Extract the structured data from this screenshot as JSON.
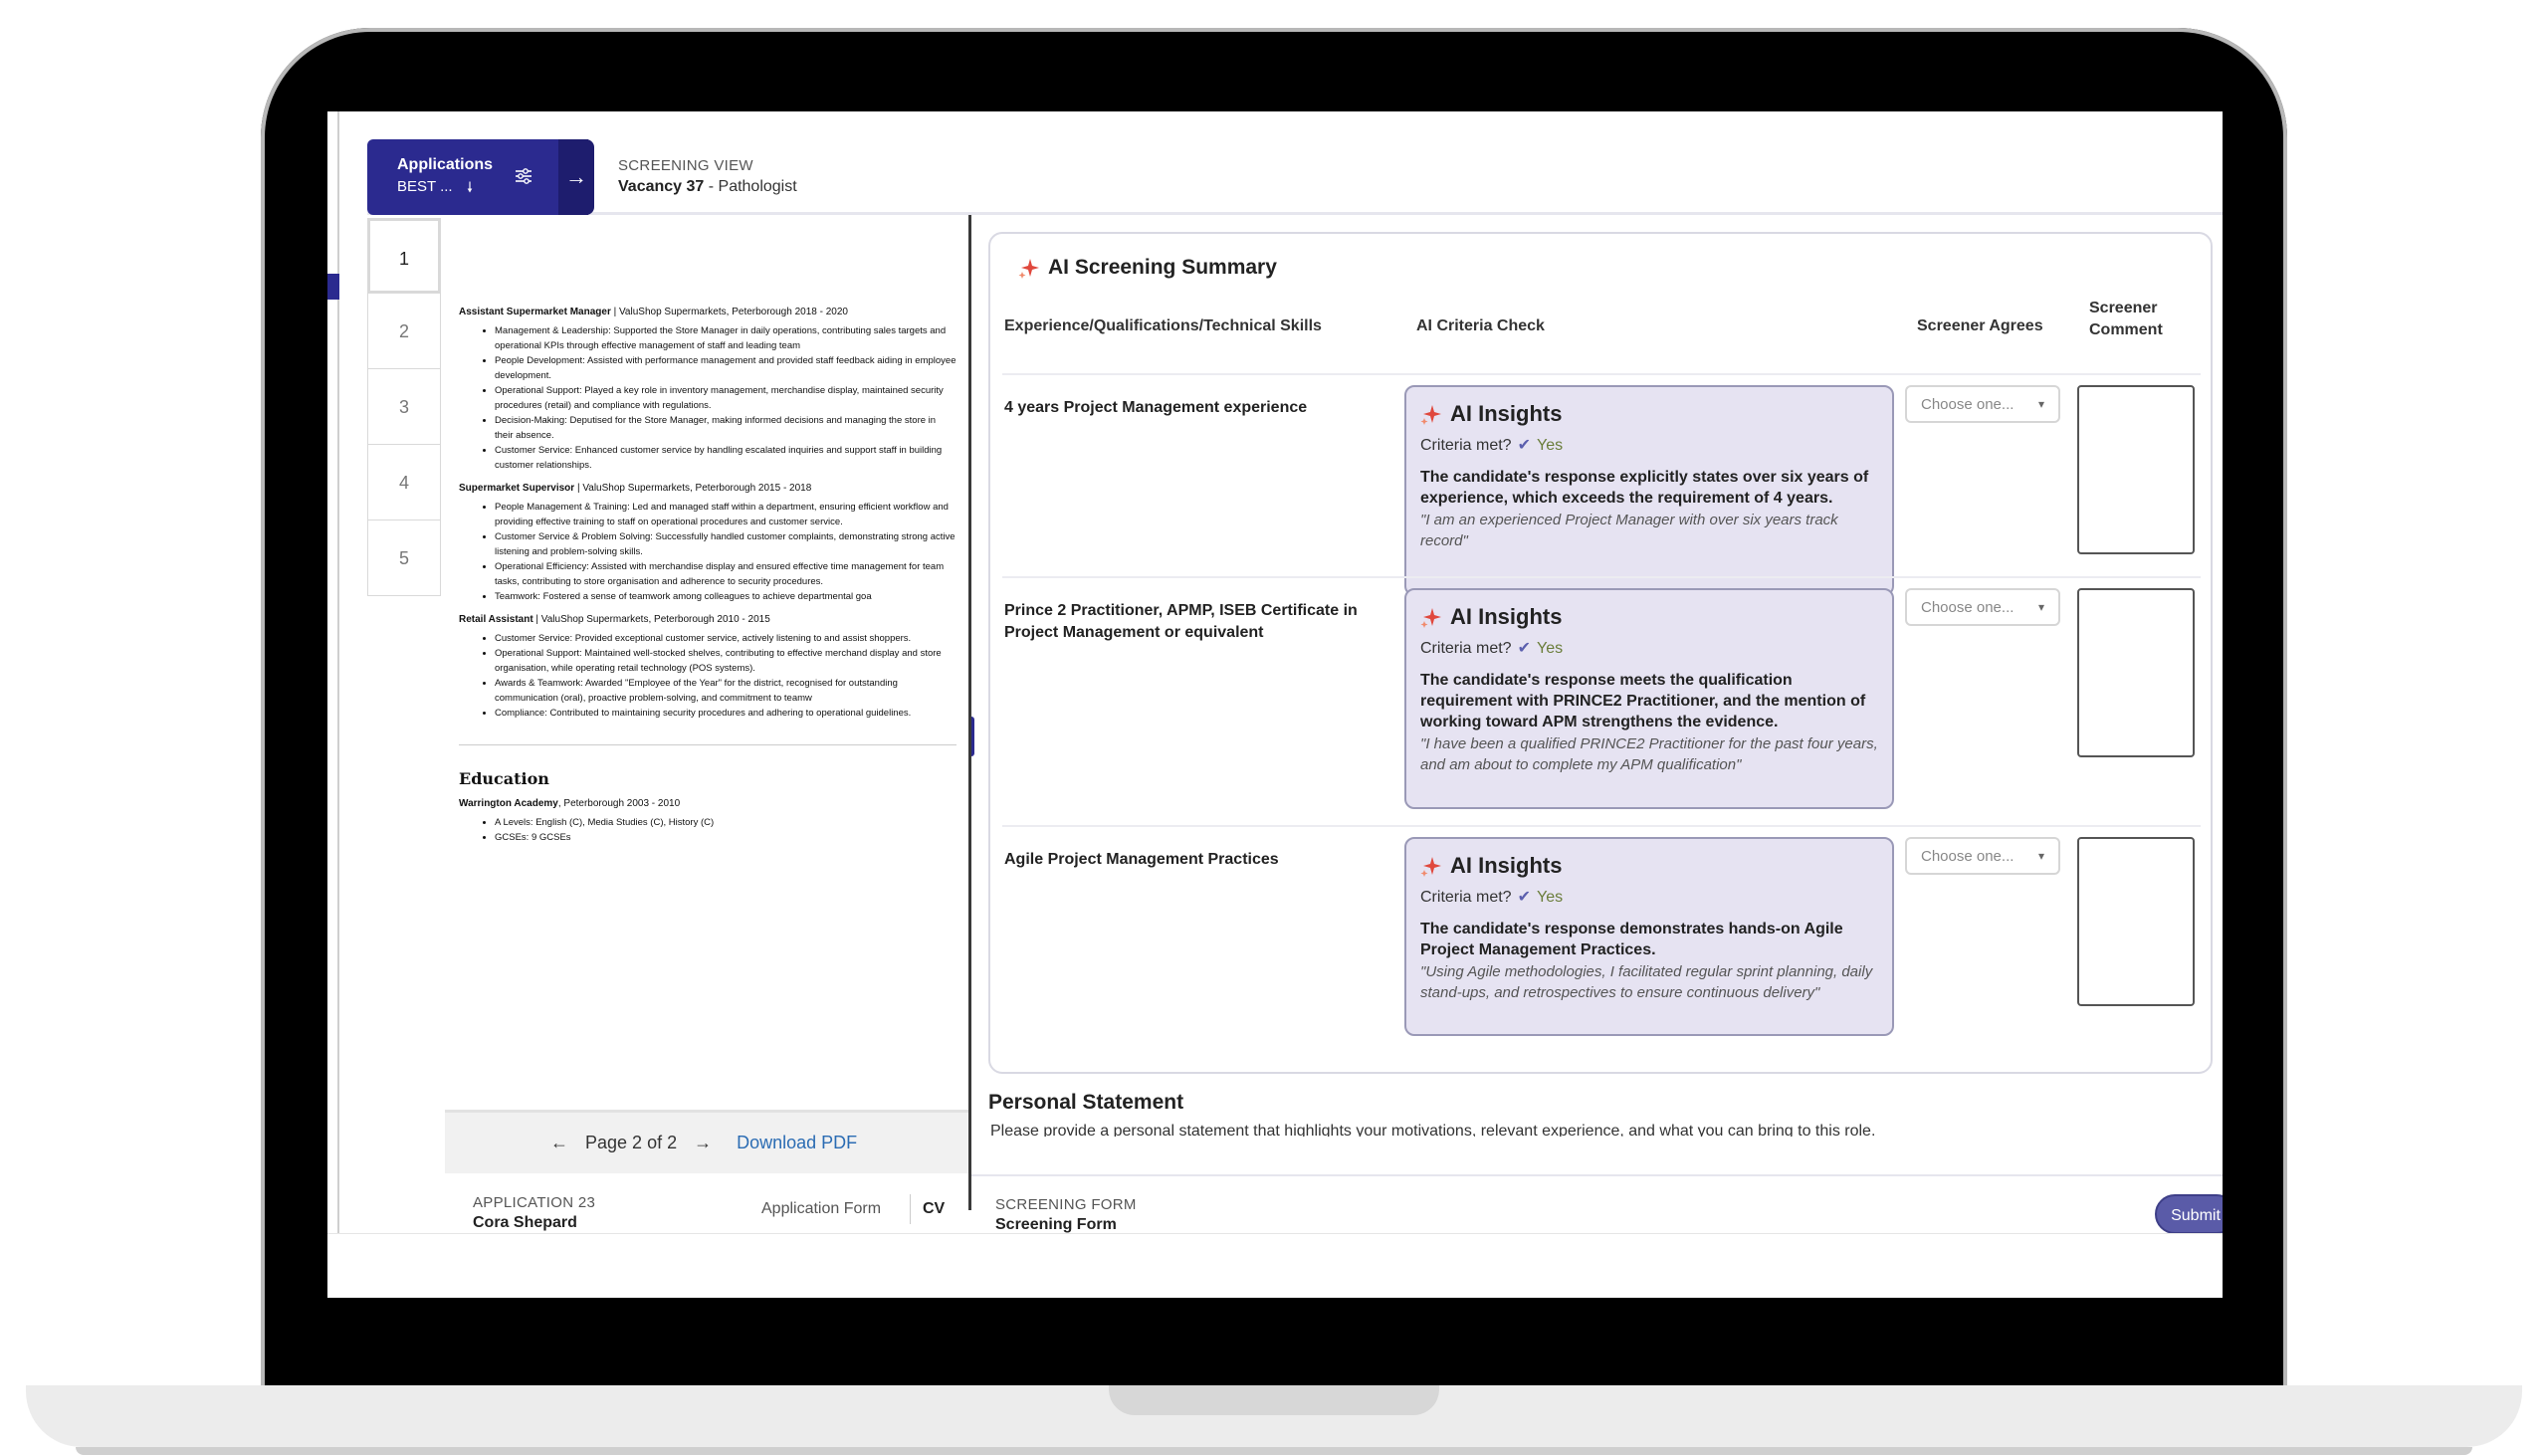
{
  "header": {
    "applications_label": "Applications",
    "sort_label": "BEST ...",
    "view_label": "SCREENING VIEW",
    "vacancy_bold": "Vacancy 37",
    "vacancy_rest": " - Pathologist"
  },
  "pages": [
    "1",
    "2",
    "3",
    "4",
    "5"
  ],
  "cv": {
    "jobs": [
      {
        "title": "Assistant Supermarket Manager",
        "meta": " | ValuShop Supermarkets, Peterborough 2018 - 2020",
        "bullets": [
          "Management & Leadership: Supported the Store Manager in daily operations, contributing sales targets and operational KPIs through effective management of staff and leading team",
          "People Development: Assisted with performance management and provided staff feedback aiding in employee development.",
          "Operational Support: Played a key role in inventory management, merchandise display, maintained security procedures (retail) and compliance with regulations.",
          "Decision-Making: Deputised for the Store Manager, making informed decisions and managing the store in their absence.",
          "Customer Service: Enhanced customer service by handling escalated inquiries and support staff in building customer relationships."
        ]
      },
      {
        "title": "Supermarket Supervisor",
        "meta": " | ValuShop Supermarkets, Peterborough 2015 - 2018",
        "bullets": [
          "People Management & Training: Led and managed staff within a department, ensuring efficient workflow and providing effective training to staff on operational procedures and customer service.",
          "Customer Service & Problem Solving: Successfully handled customer complaints, demonstrating strong active listening and problem-solving skills.",
          "Operational Efficiency: Assisted with merchandise display and ensured effective time management for team tasks, contributing to store organisation and adherence to security procedures.",
          "Teamwork: Fostered a sense of teamwork among colleagues to achieve departmental goa"
        ]
      },
      {
        "title": "Retail Assistant",
        "meta": " | ValuShop Supermarkets, Peterborough 2010 - 2015",
        "bullets": [
          "Customer Service: Provided exceptional customer service, actively listening to and assist shoppers.",
          "Operational Support: Maintained well-stocked shelves, contributing to effective merchand display and store organisation, while operating retail technology (POS systems).",
          "Awards & Teamwork: Awarded \"Employee of the Year\" for the district, recognised for outstanding communication (oral), proactive problem-solving, and commitment to teamw",
          "Compliance: Contributed to maintaining security procedures and adhering to operational guidelines."
        ]
      }
    ],
    "education_title": "Education",
    "education": {
      "title": "Warrington Academy",
      "meta": ", Peterborough 2003 - 2010",
      "bullets": [
        "A Levels: English (C), Media Studies (C), History (C)",
        "GCSEs: 9 GCSEs"
      ]
    }
  },
  "pdf_nav": {
    "page_label": "Page 2 of 2",
    "download_label": "Download PDF"
  },
  "application": {
    "label": "APPLICATION 23",
    "name": "Cora Shepard",
    "form_tab": "Application Form",
    "cv_tab": "CV"
  },
  "summary": {
    "title": "AI Screening Summary",
    "col_requirement": "Experience/Qualifications/Technical Skills",
    "col_ai": "AI Criteria Check",
    "col_agrees": "Screener Agrees",
    "col_comment_1": "Screener",
    "col_comment_2": "Comment",
    "insight_title": "AI Insights",
    "criteria_label": "Criteria met?",
    "select_placeholder": "Choose one...",
    "rows": [
      {
        "requirement": "4 years Project Management experience",
        "met": "Yes",
        "explanation": "The candidate's response explicitly states over six years of experience, which exceeds the requirement of 4 years.",
        "quote": "\"I am an experienced Project Manager with over six years track record\""
      },
      {
        "requirement": "Prince 2 Practitioner, APMP, ISEB Certificate in Project Management or equivalent",
        "met": "Yes",
        "explanation": "The candidate's response meets the qualification requirement with PRINCE2 Practitioner, and the mention of working toward APM strengthens the evidence.",
        "quote": "\"I have been a qualified PRINCE2 Practitioner for the past four years, and am about to complete my APM qualification\""
      },
      {
        "requirement": "Agile Project Management Practices",
        "met": "Yes",
        "explanation": "The candidate's response demonstrates hands-on Agile Project Management Practices.",
        "quote": "\"Using Agile methodologies, I facilitated regular sprint planning, daily stand-ups, and retrospectives to ensure continuous delivery\""
      }
    ]
  },
  "personal_statement": {
    "title": "Personal Statement",
    "text": "Please provide a personal statement that highlights your motivations, relevant experience, and what you can bring to this role."
  },
  "screening_form": {
    "label": "SCREENING FORM",
    "name": "Screening Form",
    "submit_label": "Submit"
  },
  "colors": {
    "brand": "#2b2a8f",
    "insight_bg": "#e6e3f2",
    "submit": "#5a5ba8",
    "spark": "#e0483d"
  }
}
